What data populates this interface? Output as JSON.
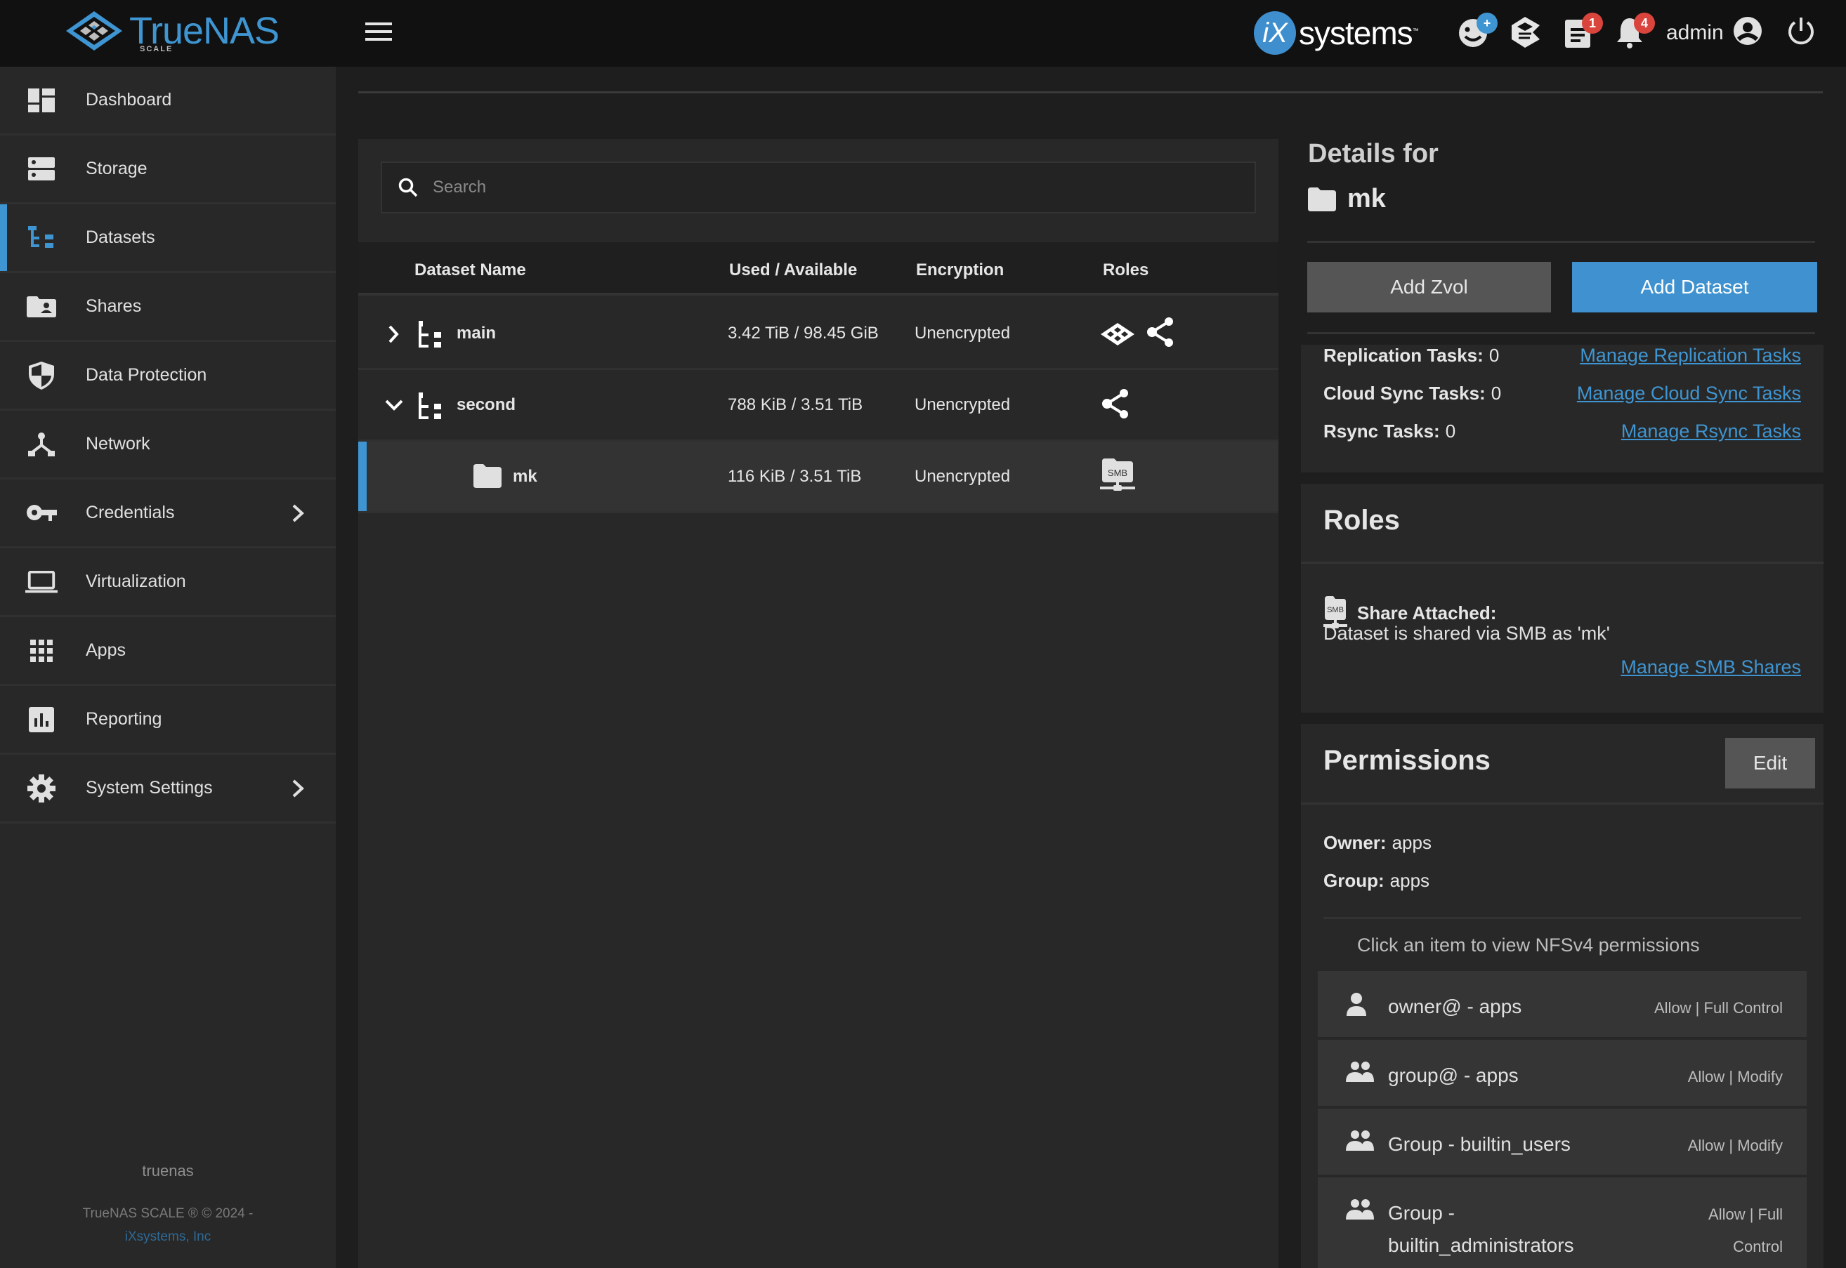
{
  "topbar": {
    "brand": "TrueNAS",
    "brand_sub": "SCALE",
    "vendor_logo": "systems",
    "vendor_logo_prefix": "iX",
    "vendor_tm": "™",
    "icons": [
      {
        "name": "feedback-icon",
        "badge": "+",
        "badge_color": "#3f95d1"
      },
      {
        "name": "truecommand-icon",
        "badge": null
      },
      {
        "name": "jobs-icon",
        "badge": "1",
        "badge_color": "#d9453c"
      },
      {
        "name": "notifications-icon",
        "badge": "4",
        "badge_color": "#d9453c"
      }
    ],
    "user": "admin"
  },
  "sidebar": {
    "items": [
      {
        "label": "Dashboard",
        "icon": "dashboard-icon",
        "active": false,
        "has_children": false
      },
      {
        "label": "Storage",
        "icon": "storage-icon",
        "active": false,
        "has_children": false
      },
      {
        "label": "Datasets",
        "icon": "datasets-icon",
        "active": true,
        "has_children": false
      },
      {
        "label": "Shares",
        "icon": "shares-icon",
        "active": false,
        "has_children": false
      },
      {
        "label": "Data Protection",
        "icon": "shield-icon",
        "active": false,
        "has_children": false
      },
      {
        "label": "Network",
        "icon": "network-icon",
        "active": false,
        "has_children": false
      },
      {
        "label": "Credentials",
        "icon": "key-icon",
        "active": false,
        "has_children": true
      },
      {
        "label": "Virtualization",
        "icon": "laptop-icon",
        "active": false,
        "has_children": false
      },
      {
        "label": "Apps",
        "icon": "apps-grid-icon",
        "active": false,
        "has_children": false
      },
      {
        "label": "Reporting",
        "icon": "reporting-icon",
        "active": false,
        "has_children": false
      },
      {
        "label": "System Settings",
        "icon": "gear-icon",
        "active": false,
        "has_children": true
      }
    ],
    "hostname": "truenas",
    "copyright": "TrueNAS SCALE ® © 2024 -",
    "copyright_link": "iXsystems, Inc"
  },
  "datasets_table": {
    "search_placeholder": "Search",
    "columns": [
      "Dataset Name",
      "Used / Available",
      "Encryption",
      "Roles"
    ],
    "rows": [
      {
        "name": "main",
        "used_available": "3.42 TiB / 98.45 GiB",
        "encryption": "Unencrypted",
        "roles": [
          "pool-icon",
          "share-icon"
        ],
        "expand": "collapsed",
        "level": 0,
        "selected": false
      },
      {
        "name": "second",
        "used_available": "788 KiB / 3.51 TiB",
        "encryption": "Unencrypted",
        "roles": [
          "share-icon"
        ],
        "expand": "expanded",
        "level": 0,
        "selected": false
      },
      {
        "name": "mk",
        "used_available": "116 KiB / 3.51 TiB",
        "encryption": "Unencrypted",
        "roles": [
          "smb-share-icon"
        ],
        "expand": "none",
        "level": 1,
        "selected": true
      }
    ]
  },
  "details": {
    "title": "Details for",
    "dataset_name": "mk",
    "add_zvol": "Add Zvol",
    "add_dataset": "Add Dataset",
    "data_protection": [
      {
        "label": "Replication Tasks:",
        "value": "0",
        "link": "Manage Replication Tasks"
      },
      {
        "label": "Cloud Sync Tasks:",
        "value": "0",
        "link": "Manage Cloud Sync Tasks"
      },
      {
        "label": "Rsync Tasks:",
        "value": "0",
        "link": "Manage Rsync Tasks"
      }
    ],
    "roles": {
      "title": "Roles",
      "share_attached": "Share Attached:",
      "description": "Dataset is shared via SMB as 'mk'",
      "link": "Manage SMB Shares"
    },
    "permissions": {
      "title": "Permissions",
      "edit": "Edit",
      "owner_label": "Owner:",
      "owner": "apps",
      "group_label": "Group:",
      "group": "apps",
      "hint": "Click an item to view NFSv4 permissions",
      "aces": [
        {
          "who": "owner@ - apps",
          "perm": "Allow | Full Control",
          "icon": "person-icon"
        },
        {
          "who": "group@ - apps",
          "perm": "Allow | Modify",
          "icon": "group-icon"
        },
        {
          "who": "Group - builtin_users",
          "perm": "Allow | Modify",
          "icon": "group-icon"
        },
        {
          "who": "Group - builtin_administrators",
          "perm": "Allow | Full Control",
          "icon": "group-icon"
        }
      ]
    }
  },
  "colors": {
    "accent": "#3f95d1",
    "badge_red": "#d9453c",
    "topbar_bg": "#111111",
    "sidebar_bg": "#282828",
    "main_bg": "#1e1e1e"
  }
}
